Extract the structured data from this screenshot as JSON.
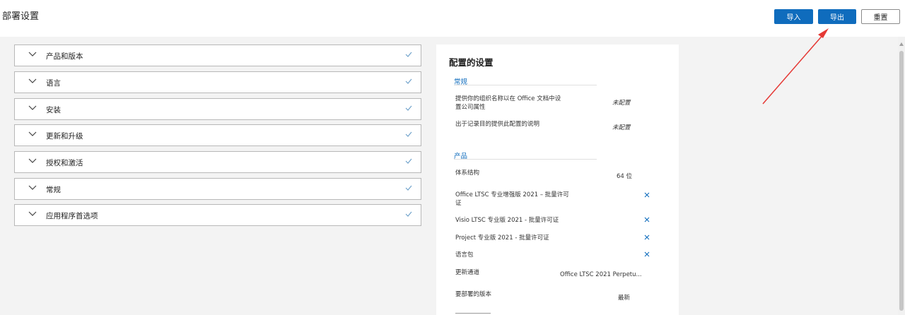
{
  "header": {
    "title": "部署设置",
    "import_label": "导入",
    "export_label": "导出",
    "reset_label": "重置"
  },
  "accordion": [
    {
      "label": "产品和版本",
      "completed": true
    },
    {
      "label": "语言",
      "completed": true
    },
    {
      "label": "安装",
      "completed": true
    },
    {
      "label": "更新和升级",
      "completed": true
    },
    {
      "label": "授权和激活",
      "completed": true
    },
    {
      "label": "常规",
      "completed": true
    },
    {
      "label": "应用程序首选项",
      "completed": true
    }
  ],
  "summary": {
    "title": "配置的设置",
    "general": {
      "heading": "常规",
      "rows": [
        {
          "label_line1": "提供你的组织名称以在 Office 文档中设",
          "label_line2": "置公司属性",
          "value": "未配置"
        },
        {
          "label": "出于记录目的提供此配置的说明",
          "value": "未配置"
        }
      ]
    },
    "product": {
      "heading": "产品",
      "architecture": {
        "label": "体系结构",
        "value": "64 位"
      },
      "items": [
        {
          "label_line1": "Office LTSC 专业增强版 2021 – 批量许可",
          "label_line2": "证"
        },
        {
          "label": "Visio LTSC 专业版 2021 - 批量许可证"
        },
        {
          "label": "Project 专业版 2021 - 批量许可证"
        },
        {
          "label": "语言包"
        }
      ],
      "update_channel": {
        "label": "更新通道",
        "value": "Office LTSC 2021 Perpetu..."
      },
      "version": {
        "label": "要部署的版本",
        "value": "最新"
      }
    }
  },
  "colors": {
    "accent": "#0f6cbd",
    "annotation_arrow": "#e53935",
    "check": "#6b9fc9"
  },
  "icons": {
    "chevron": "chevron-down-icon",
    "check": "checkmark-icon",
    "remove": "remove-x-icon"
  }
}
